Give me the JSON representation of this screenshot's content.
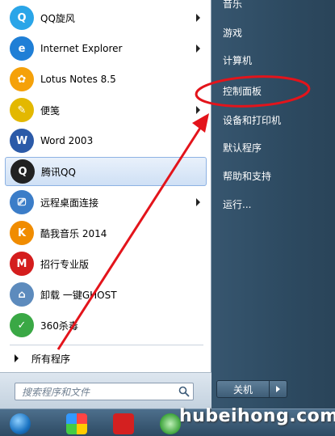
{
  "programs": [
    {
      "label": "QQ旋风",
      "icon": "qq-cyclone-icon",
      "color": "#2aa5e8",
      "glyph": "Q",
      "arrow": true
    },
    {
      "label": "Internet Explorer",
      "icon": "internet-explorer-icon",
      "color": "#1f7fd6",
      "glyph": "e",
      "arrow": true
    },
    {
      "label": "Lotus Notes 8.5",
      "icon": "lotus-notes-icon",
      "color": "#f5a10a",
      "glyph": "✿",
      "arrow": false
    },
    {
      "label": "便笺",
      "icon": "sticky-notes-icon",
      "color": "#e3b800",
      "glyph": "✎",
      "arrow": true
    },
    {
      "label": "Word 2003",
      "icon": "word-icon",
      "color": "#2b5aa8",
      "glyph": "W",
      "arrow": false
    },
    {
      "label": "腾讯QQ",
      "icon": "tencent-qq-icon",
      "color": "#222222",
      "glyph": "Q",
      "arrow": false
    },
    {
      "label": "远程桌面连接",
      "icon": "remote-desktop-icon",
      "color": "#3b7dc8",
      "glyph": "⎚",
      "arrow": true
    },
    {
      "label": "酷我音乐 2014",
      "icon": "kuwo-music-icon",
      "color": "#f08c00",
      "glyph": "K",
      "arrow": false
    },
    {
      "label": "招行专业版",
      "icon": "cmb-bank-icon",
      "color": "#d41d1d",
      "glyph": "M",
      "arrow": false
    },
    {
      "label": "卸载 一键GHOST",
      "icon": "uninstall-ghost-icon",
      "color": "#5d8bbd",
      "glyph": "⌂",
      "arrow": false
    },
    {
      "label": "360杀毒",
      "icon": "360-antivirus-icon",
      "color": "#3aa845",
      "glyph": "✓",
      "arrow": false
    }
  ],
  "all_programs": "所有程序",
  "search": {
    "placeholder": "搜索程序和文件"
  },
  "right_menu": [
    {
      "label": "音乐",
      "name": "right-item-music"
    },
    {
      "label": "游戏",
      "name": "right-item-games"
    },
    {
      "label": "计算机",
      "name": "right-item-computer"
    },
    {
      "label": "控制面板",
      "name": "right-item-control-panel"
    },
    {
      "label": "设备和打印机",
      "name": "right-item-devices-printers"
    },
    {
      "label": "默认程序",
      "name": "right-item-default-programs"
    },
    {
      "label": "帮助和支持",
      "name": "right-item-help-support"
    },
    {
      "label": "运行...",
      "name": "right-item-run"
    }
  ],
  "shutdown_label": "关机",
  "watermark": "hubeihong.com",
  "colors": {
    "annotation_red": "#e3141b"
  }
}
